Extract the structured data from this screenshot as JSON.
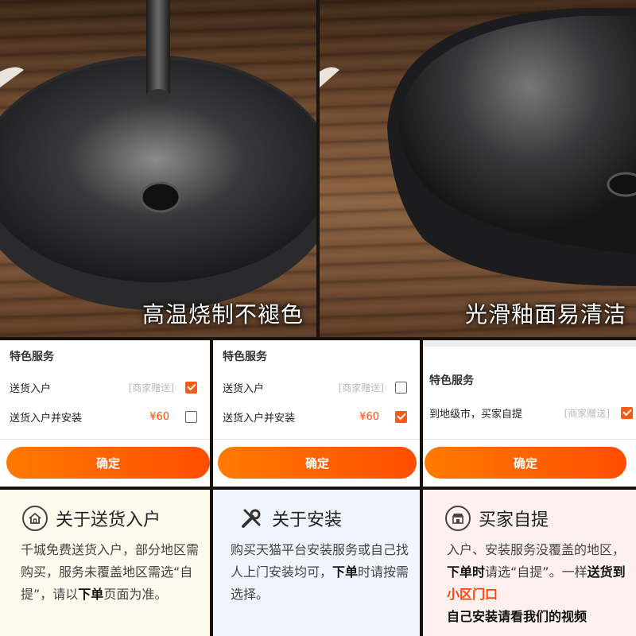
{
  "photos": {
    "left_caption": "高温烧制不褪色",
    "right_caption": "光滑釉面易清洁"
  },
  "panels": [
    {
      "title": "特色服务",
      "options": [
        {
          "label": "送货入户",
          "tag": "[商家赠送]",
          "price": "",
          "checked": true
        },
        {
          "label": "送货入户并安装",
          "tag": "",
          "price": "¥60",
          "checked": false
        }
      ],
      "confirm": "确定"
    },
    {
      "title": "特色服务",
      "options": [
        {
          "label": "送货入户",
          "tag": "[商家赠送]",
          "price": "",
          "checked": false
        },
        {
          "label": "送货入户并安装",
          "tag": "",
          "price": "¥60",
          "checked": true
        }
      ],
      "confirm": "确定"
    },
    {
      "title": "特色服务",
      "options": [
        {
          "label": "到地级市，买家自提",
          "tag": "[商家赠送]",
          "price": "",
          "checked": true
        }
      ],
      "confirm": "确定"
    }
  ],
  "cards": [
    {
      "icon": "home-icon",
      "title": "关于送货入户",
      "body_parts": [
        "千城免费送货入户，部分地区需购买，服务未覆盖地区需选“自提”，请以",
        "下单",
        "页面为准。"
      ]
    },
    {
      "icon": "tools-icon",
      "title": "关于安装",
      "body_parts": [
        "购买天猫平台安装服务或自己找人上门安装均可，",
        "下单",
        "时请按需选择。"
      ]
    },
    {
      "icon": "store-icon",
      "title": "买家自提",
      "body_parts": [
        "入户、安装服务没覆盖的地区，",
        "下单时",
        "请选“自提”。一样",
        "送货到",
        "小区门口",
        "自己安装请看我们的视频"
      ]
    }
  ],
  "colors": {
    "accent": "#ff5000",
    "checkbox_on": "#ff5a14"
  }
}
